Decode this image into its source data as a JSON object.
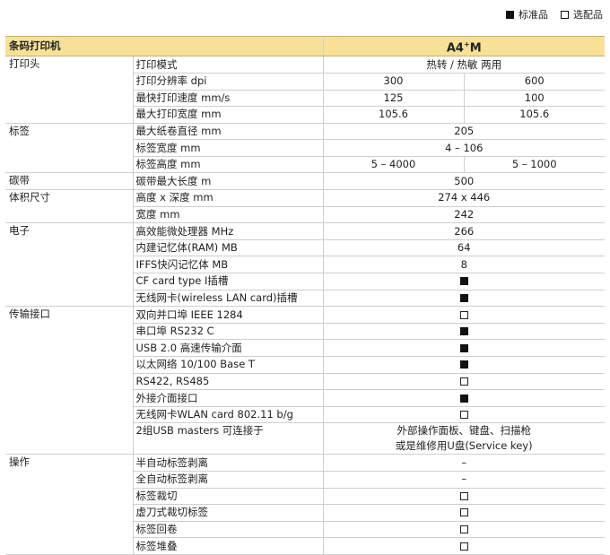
{
  "legend": {
    "standard": "标准品",
    "optional": "选配品"
  },
  "header": {
    "category": "条码打印机",
    "model_base": "A4",
    "model_sup": "+",
    "model_suffix": "M"
  },
  "sections": {
    "printhead": "打印头",
    "label": "标签",
    "ribbon": "碳带",
    "dimensions": "体积尺寸",
    "electronics": "电子",
    "interfaces": "传输接口",
    "operation": "操作"
  },
  "rows": {
    "mode": {
      "feature": "打印模式",
      "value": "热转 / 热敏  两用"
    },
    "resolution": {
      "feature": "打印分辨率 dpi",
      "v1": "300",
      "v2": "600"
    },
    "speed": {
      "feature": "最快打印速度 mm/s",
      "v1": "125",
      "v2": "100"
    },
    "width": {
      "feature": "最大打印宽度 mm",
      "v1": "105.6",
      "v2": "105.6"
    },
    "roll_dia": {
      "feature": "最大纸卷直径 mm",
      "value": "205"
    },
    "label_width": {
      "feature": "标签宽度 mm",
      "value": "4 – 106"
    },
    "label_height": {
      "feature": "标签高度 mm",
      "v1": "5 – 4000",
      "v2": "5 – 1000"
    },
    "ribbon_len": {
      "feature": "碳带最大长度 m",
      "value": "500"
    },
    "hd": {
      "feature": "高度 x 深度 mm",
      "value": "274 x 446"
    },
    "w": {
      "feature": "宽度 mm",
      "value": "242"
    },
    "cpu": {
      "feature": "高效能微处理器  MHz",
      "value": "266"
    },
    "ram": {
      "feature": "内建记忆体(RAM) MB",
      "value": "64"
    },
    "iffs": {
      "feature": "IFFS快闪记忆体 MB",
      "value": "8"
    },
    "cf": {
      "feature": "CF card type I插槽",
      "symbol": "filled"
    },
    "wlan_slot": {
      "feature": "无线网卡(wireless LAN card)插槽",
      "symbol": "filled"
    },
    "ieee": {
      "feature": "双向并口埠 IEEE 1284",
      "symbol": "empty"
    },
    "rs232": {
      "feature": "串口埠 RS232 C",
      "symbol": "filled"
    },
    "usb": {
      "feature": "USB 2.0 高速传输介面",
      "symbol": "filled"
    },
    "eth": {
      "feature": "以太网络 10/100 Base T",
      "symbol": "filled"
    },
    "rs422": {
      "feature": "RS422, RS485",
      "symbol": "empty"
    },
    "ext": {
      "feature": "外接介面接口",
      "symbol": "filled"
    },
    "wlan_card": {
      "feature": "无线网卡WLAN card 802.11 b/g",
      "symbol": "empty"
    },
    "usb_masters": {
      "feature": "2组USB masters 可连接于",
      "line1": "外部操作面板、键盘、扫描枪",
      "line2": "或是维修用U盘(Service key)"
    },
    "peel_semi": {
      "feature": "半自动标签剥离",
      "symbol": "dash",
      "text": "–"
    },
    "peel_full": {
      "feature": "全自动标签剥离",
      "symbol": "dash",
      "text": "–"
    },
    "cut": {
      "feature": "标签裁切",
      "symbol": "empty"
    },
    "perf": {
      "feature": "虚刀式裁切标签",
      "symbol": "empty"
    },
    "rewind": {
      "feature": "标签回卷",
      "symbol": "empty"
    },
    "stack": {
      "feature": "标签堆叠",
      "symbol": "empty"
    }
  }
}
